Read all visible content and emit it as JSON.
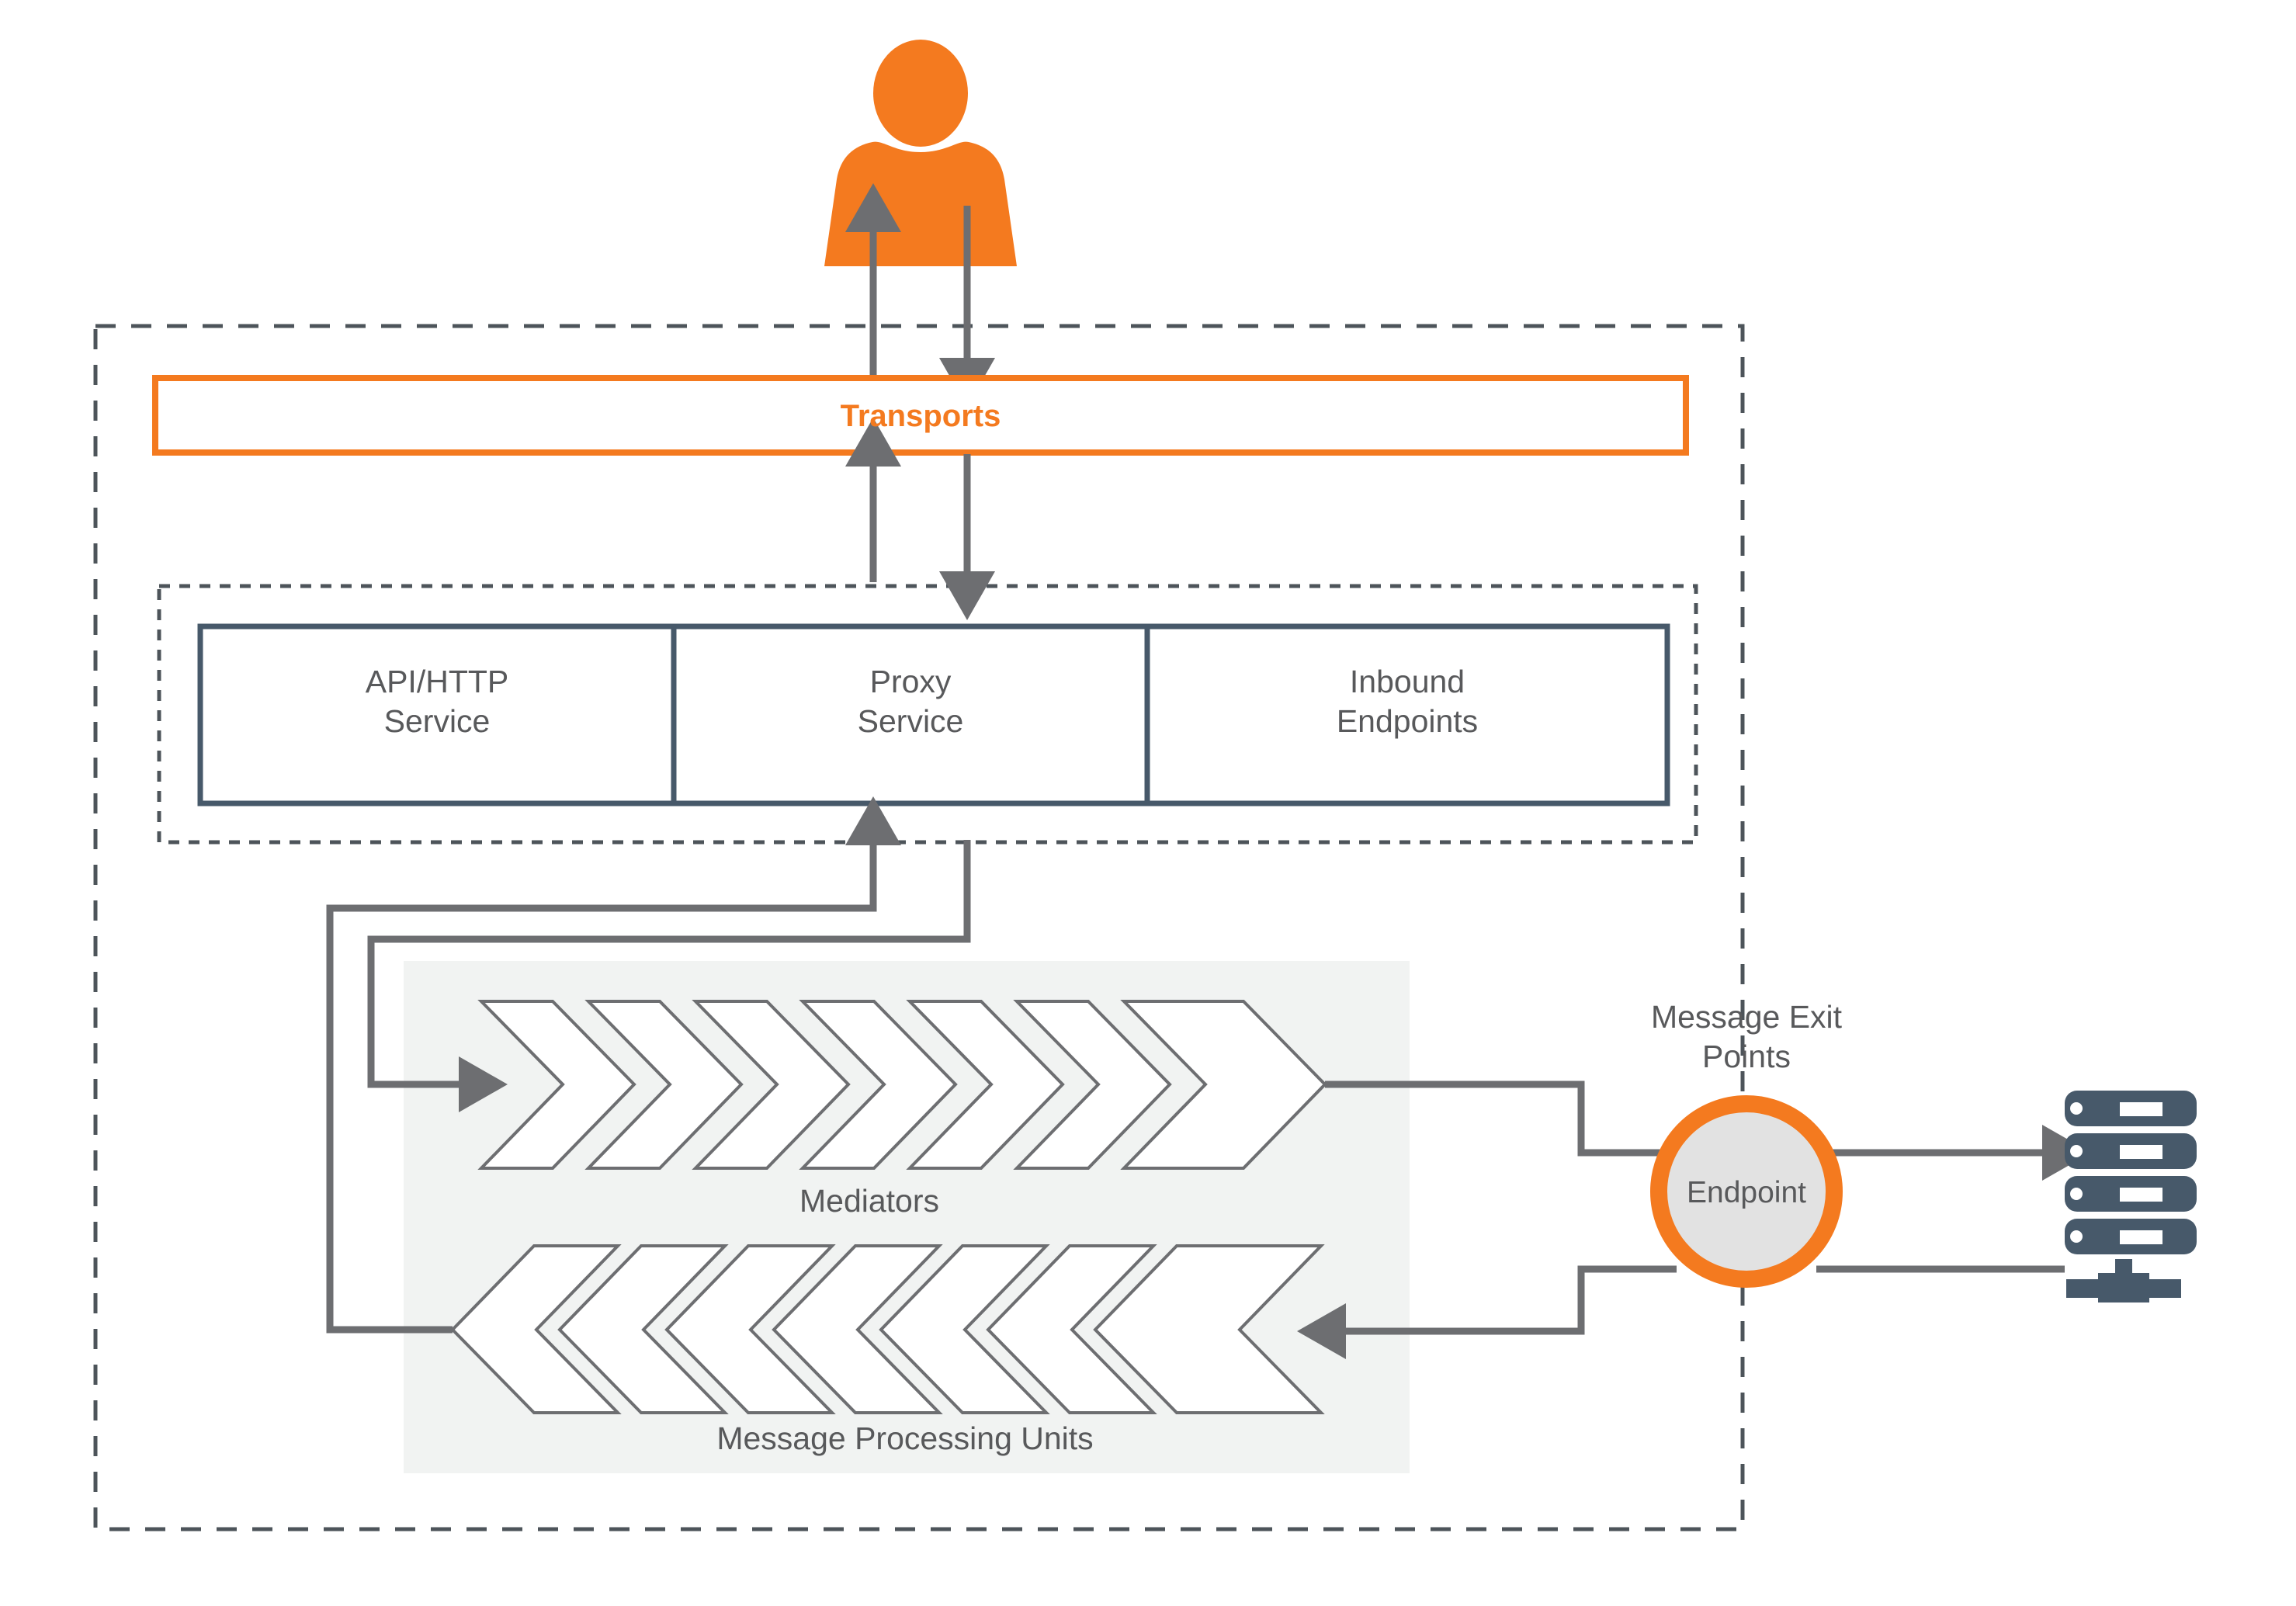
{
  "diagram": {
    "title": "WSO2 Message Flow Architecture",
    "colors": {
      "orange": "#f47a1f",
      "slate": "#47596a",
      "gray_line": "#6d6e71",
      "text_gray": "#58595b",
      "panel_gray": "#f1f3f2",
      "endpoint_fill": "#e2e2e2",
      "dash_gray": "#4d545a",
      "white": "#ffffff"
    },
    "actor": {
      "name": "user-actor",
      "icon": "person-icon"
    },
    "transports": {
      "label": "Transports"
    },
    "services": [
      {
        "id": "api-http-service",
        "label": "API/HTTP\nService"
      },
      {
        "id": "proxy-service",
        "label": "Proxy\nService"
      },
      {
        "id": "inbound-endpoints",
        "label": "Inbound\nEndpoints"
      }
    ],
    "processing": {
      "mediators_label": "Mediators",
      "units_label": "Message Processing Units",
      "chevrons_forward": 7,
      "chevrons_reverse": 7
    },
    "exit": {
      "label": "Message Exit\nPoints",
      "endpoint_label": "Endpoint",
      "backend_icon": "server-stack-icon"
    }
  }
}
